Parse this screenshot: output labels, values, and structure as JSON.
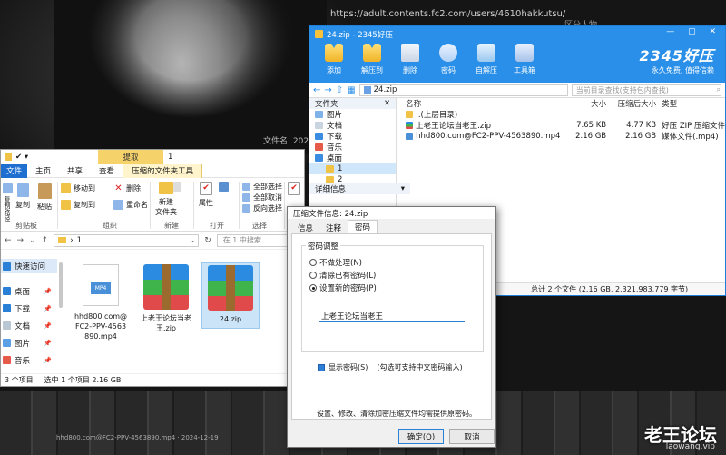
{
  "background": {
    "url_text": "https://adult.contents.fc2.com/users/4610hakkutsu/",
    "ghost_text": "区分人物",
    "file_info": "文件名: 2024120",
    "filmstrip_caption": "hhd800.com@FC2-PPV-4563890.mp4 · 2024-12-19",
    "watermark": "老王论坛",
    "watermark_url": "laowang.vip"
  },
  "archiver": {
    "title": "24.zip - 2345好压",
    "toolbar": [
      {
        "label": "添加",
        "icon": "add-archive-icon"
      },
      {
        "label": "解压到",
        "icon": "extract-icon"
      },
      {
        "label": "删除",
        "icon": "trash-icon"
      },
      {
        "label": "密码",
        "icon": "password-icon"
      },
      {
        "label": "自解压",
        "icon": "self-extract-icon"
      },
      {
        "label": "工具箱",
        "icon": "toolbox-icon"
      }
    ],
    "brand": "2345好压",
    "slogan": "永久免费, 值得信赖",
    "path": "24.zip",
    "search_placeholder": "当前目录查找(支持包内查找)",
    "left_header": "文件夹",
    "tree": [
      "图片",
      "文档",
      "下载",
      "音乐",
      "桌面",
      "1",
      "2"
    ],
    "details_header": "详细信息",
    "columns": {
      "name": "名称",
      "size": "大小",
      "compressed": "压缩后大小",
      "type": "类型"
    },
    "rows": [
      {
        "name": "..(上层目录)",
        "size": "",
        "compressed": "",
        "type": ""
      },
      {
        "name": "上老王论坛当老王.zip",
        "size": "7.65 KB",
        "compressed": "4.77 KB",
        "type": "好压 ZIP 压缩文件"
      },
      {
        "name": "hhd800.com@FC2-PPV-4563890.mp4",
        "size": "2.16 GB",
        "compressed": "2.16 GB",
        "type": "媒体文件(.mp4)"
      }
    ],
    "status": "总计 2 个文件 (2.16 GB, 2,321,983,779 字节)"
  },
  "explorer": {
    "title_num": "1",
    "context_tab": "提取",
    "tabs": [
      "文件",
      "主页",
      "共享",
      "查看",
      "压缩的文件夹工具"
    ],
    "ribbon": {
      "clipboard": [
        "复制路径",
        "复制",
        "粘贴"
      ],
      "move_to": "移动到",
      "copy_to": "复制到",
      "delete": "删除",
      "rename": "重命名",
      "new_folder": "新建\n文件夹",
      "properties": "属性",
      "select_all": "全部选择",
      "select_none": "全部取消",
      "invert": "反向选择",
      "groups": [
        "剪贴板",
        "组织",
        "新建",
        "打开",
        "选择"
      ]
    },
    "address": "1",
    "search_placeholder": "在 1 中搜索",
    "sidebar": [
      {
        "label": "快速访问",
        "icon": "star-icon"
      },
      {
        "label": "桌面",
        "icon": "desktop-icon"
      },
      {
        "label": "下载",
        "icon": "download-icon"
      },
      {
        "label": "文档",
        "icon": "document-icon"
      },
      {
        "label": "图片",
        "icon": "picture-icon"
      },
      {
        "label": "音乐",
        "icon": "music-icon"
      }
    ],
    "files": [
      {
        "name": "hhd800.com@FC2-PPV-4563890.mp4",
        "icon": "mp4-file-icon"
      },
      {
        "name": "上老王论坛当老王.zip",
        "icon": "rar-archive-icon"
      },
      {
        "name": "24.zip",
        "icon": "rar-archive-icon"
      }
    ],
    "status_count": "3 个项目",
    "status_sel": "选中 1 个项目  2.16 GB"
  },
  "dialog": {
    "title": "压缩文件信息: 24.zip",
    "tabs": [
      "信息",
      "注释",
      "密码"
    ],
    "group_label": "密码调整",
    "options": [
      "不做处理(N)",
      "清除已有密码(L)",
      "设置新的密码(P)"
    ],
    "selected_option": 2,
    "password_value": "上老王论坛当老王",
    "show_password": "显示密码(S)",
    "hint": "(勾选可支持中文密码输入)",
    "note": "设置、修改、清除加密压缩文件均需提供原密码。",
    "ok": "确定(O)",
    "cancel": "取消"
  },
  "colors": {
    "accent": "#2a8fe8",
    "file_tab": "#1f6fd1",
    "zip_tab": "#f6d36a"
  }
}
